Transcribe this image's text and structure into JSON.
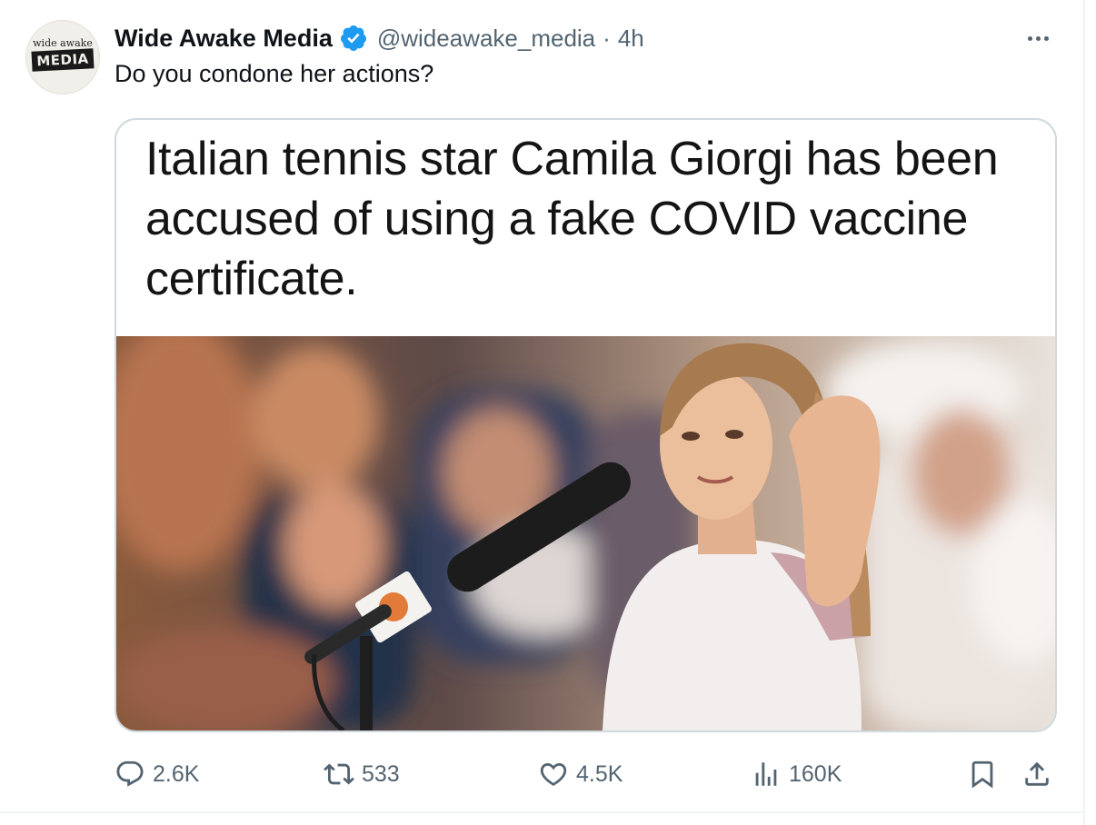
{
  "author": {
    "avatar_top_text": "wide awake",
    "avatar_bottom_text": "MEDIA",
    "display_name": "Wide Awake Media",
    "handle": "@wideawake_media",
    "separator": "·",
    "timestamp": "4h",
    "verified_icon": "verified-badge-icon"
  },
  "tweet": {
    "text": "Do you condone her actions?"
  },
  "media": {
    "headline": "Italian tennis star Camila Giorgi has been accused of using a fake COVID vaccine certificate."
  },
  "actions": {
    "replies": "2.6K",
    "reposts": "533",
    "likes": "4.5K",
    "views": "160K"
  },
  "colors": {
    "text_primary": "#0f1419",
    "text_secondary": "#536471",
    "verified_blue": "#1d9bf0",
    "border": "#cfd9de"
  }
}
